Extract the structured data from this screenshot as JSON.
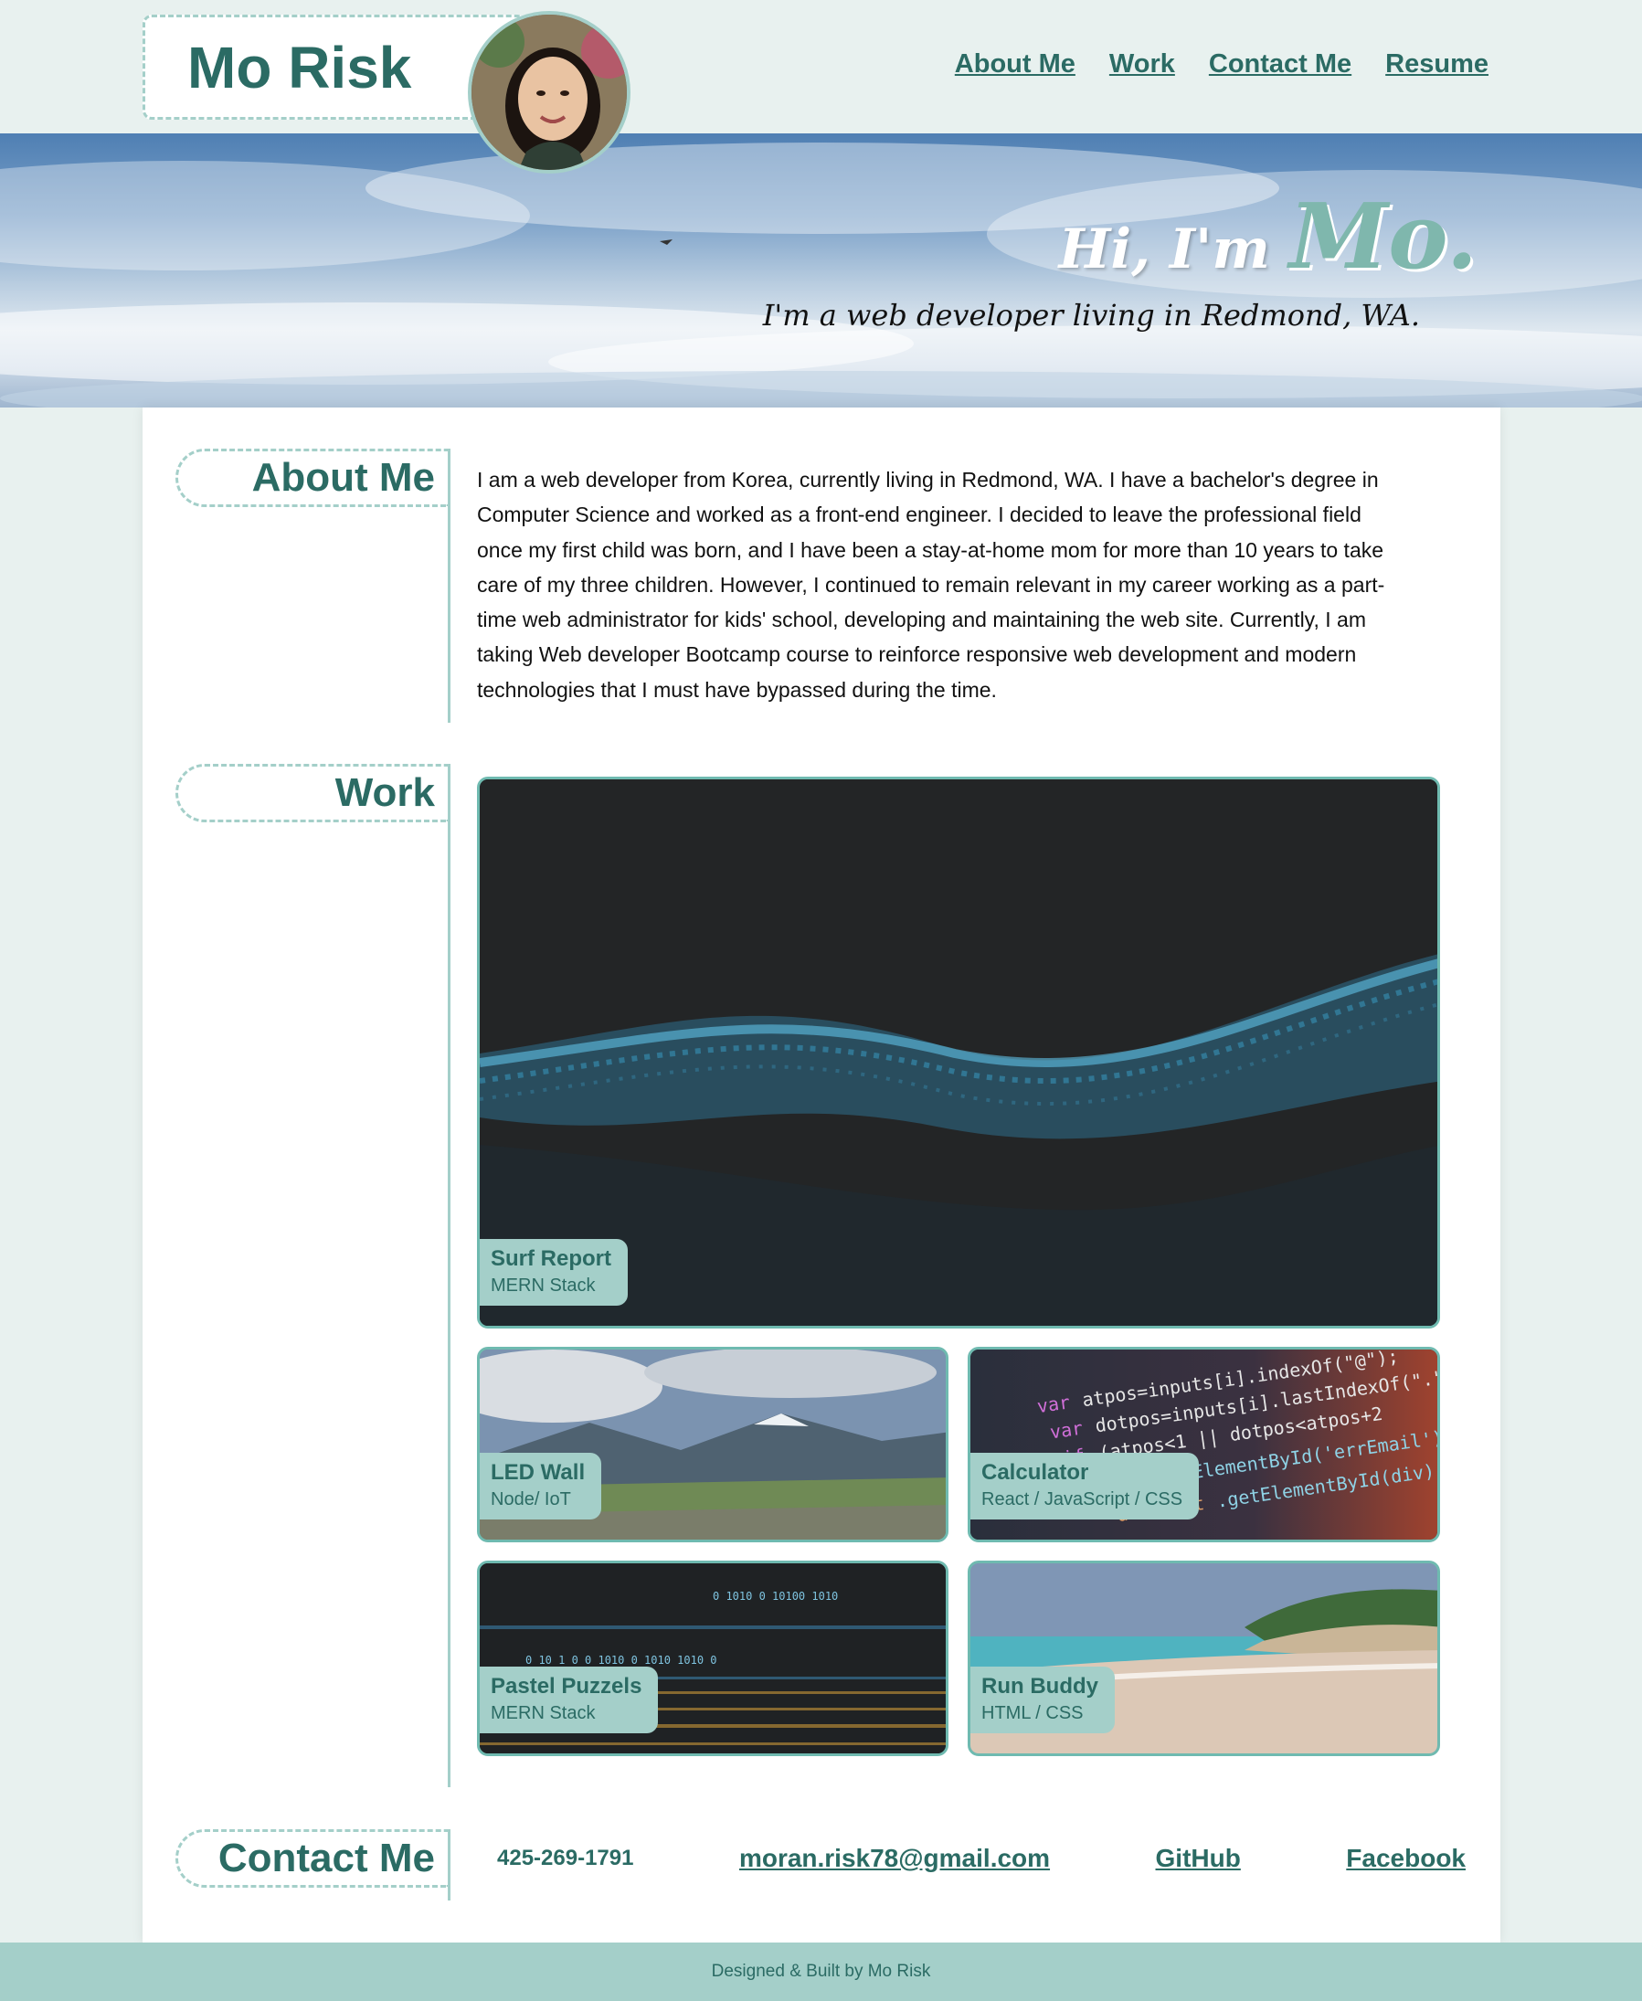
{
  "brand": {
    "name": "Mo Risk",
    "accent": "#2b6b64",
    "light_accent": "#a4cfc9",
    "background": "#e8f1ef"
  },
  "nav": {
    "items": [
      {
        "label": "About Me"
      },
      {
        "label": "Work"
      },
      {
        "label": "Contact Me"
      },
      {
        "label": "Resume"
      }
    ]
  },
  "hero": {
    "greeting": "Hi, I'm",
    "name": "Mo.",
    "subtitle": "I'm a web developer living in Redmond, WA."
  },
  "about": {
    "heading": "About Me",
    "text": "I am a web developer from Korea, currently living in Redmond, WA. I have a bachelor's degree in Computer Science and worked as a front-end engineer. I decided to leave the professional field once my first child was born, and I have been a stay-at-home mom for more than 10 years to take care of my three children. However, I continued to remain relevant in my career working as a part-time web administrator for kids' school, developing and maintaining the web site. Currently, I am taking Web developer Bootcamp course to reinforce responsive web development and modern technologies that I must have bypassed during the time."
  },
  "work": {
    "heading": "Work",
    "projects": [
      {
        "title": "Surf Report",
        "stack": "MERN Stack",
        "image": "digital-wave"
      },
      {
        "title": "LED Wall",
        "stack": "Node/ IoT",
        "image": "mountain-meadow"
      },
      {
        "title": "Calculator",
        "stack": "React / JavaScript / CSS",
        "image": "code-screen"
      },
      {
        "title": "Pastel Puzzels",
        "stack": "MERN Stack",
        "image": "binary-lights"
      },
      {
        "title": "Run Buddy",
        "stack": "HTML / CSS",
        "image": "beach"
      }
    ]
  },
  "contact": {
    "heading": "Contact Me",
    "phone": "425-269-1791",
    "email": "moran.risk78@gmail.com",
    "github": "GitHub",
    "facebook": "Facebook"
  },
  "footer": {
    "text": "Designed & Built by Mo Risk"
  }
}
